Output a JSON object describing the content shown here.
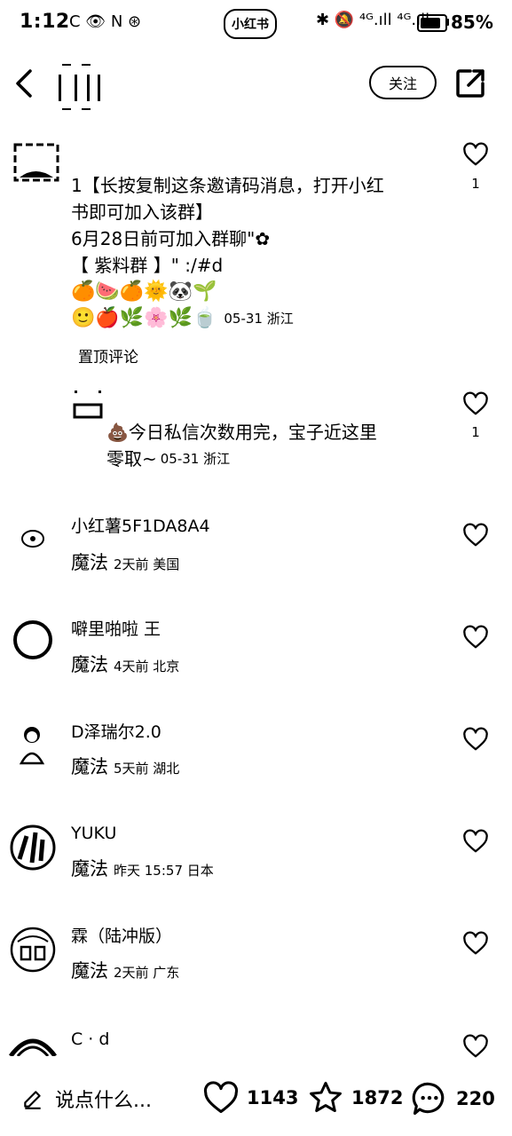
{
  "status_bar": {
    "time": "1:12",
    "left_icons": "C 👁 N ⊛",
    "center_logo": "小红书",
    "network": "✱ 🔕 ⁴ᴳ.ıll ⁴ᴳ.ıll",
    "battery_pct": "85%"
  },
  "header": {
    "follow_label": "关注"
  },
  "comments": [
    {
      "text_line1": "1【长按复制这条邀请码消息，打开小红",
      "text_line2": "书即可加入该群】",
      "text_line3": "6月28日前可加入群聊\"✿",
      "text_line4": "【 紫料群 】\" :/#d",
      "emoji_line1": "🍊🍉🍊🌞🐼🌱",
      "emoji_line2": "🙂🍎🌿🌸🌿🍵",
      "meta": "05-31 浙江",
      "pinned": "置顶评论",
      "likes": "1"
    },
    {
      "text_line1": "💩今日私信次数用完，宝子近这里",
      "text_line2": "零取~",
      "meta": "05-31 浙江",
      "likes": "1"
    }
  ],
  "replies": [
    {
      "name": "小红薯5F1DA8A4",
      "label": "魔法",
      "meta": "2天前  美国"
    },
    {
      "name": "噼里啪啦 王",
      "label": "魔法",
      "meta": "4天前  北京"
    },
    {
      "name": "D泽瑞尔2.0",
      "label": "魔法",
      "meta": "5天前  湖北"
    },
    {
      "name": "YUKU",
      "label": "魔法",
      "meta": "昨天 15:57  日本"
    },
    {
      "name": "霖（陆冲版）",
      "label": "魔法",
      "meta": "2天前  广东"
    },
    {
      "name": "C · d",
      "label": "",
      "meta": ""
    }
  ],
  "bottom_bar": {
    "input_placeholder": "说点什么...",
    "likes": "1143",
    "stars": "1872",
    "comments": "220"
  },
  "icons": {
    "back": "back-icon",
    "share": "share-icon",
    "heart": "heart-icon",
    "star": "star-icon",
    "comment": "comment-icon",
    "pencil": "pencil-icon"
  }
}
